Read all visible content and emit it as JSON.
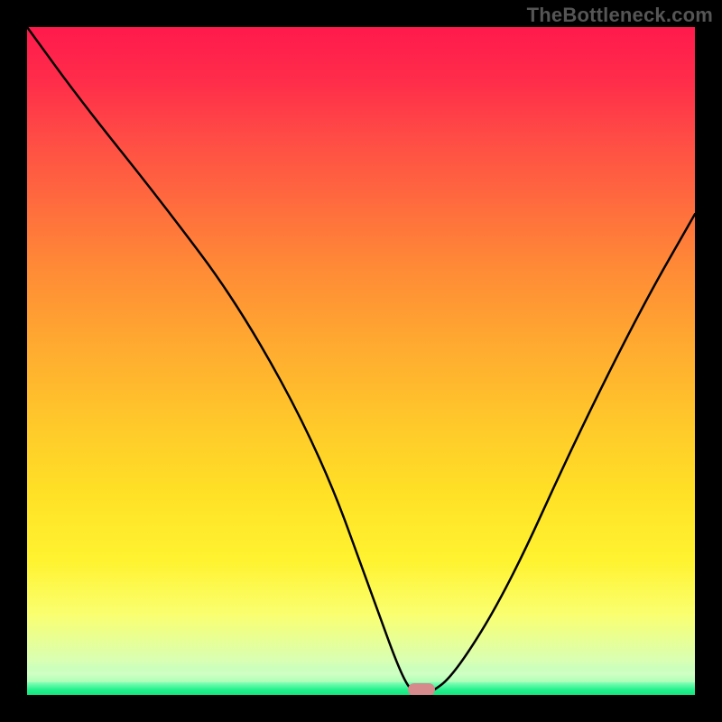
{
  "watermark": "TheBottleneck.com",
  "chart_data": {
    "type": "line",
    "title": "",
    "xlabel": "",
    "ylabel": "",
    "xlim": [
      0,
      100
    ],
    "ylim": [
      0,
      100
    ],
    "series": [
      {
        "name": "bottleneck-curve",
        "x": [
          0,
          8,
          20,
          32,
          44,
          52,
          56,
          58,
          60,
          64,
          72,
          82,
          92,
          100
        ],
        "values": [
          100,
          89,
          74,
          58,
          36,
          14,
          3,
          0,
          0,
          3,
          16,
          38,
          58,
          72
        ]
      }
    ],
    "marker": {
      "x": 59,
      "y": 0,
      "name": "optimal-point"
    },
    "background": {
      "gradient_stops": [
        {
          "pos": 0,
          "color": "#ff1a4c"
        },
        {
          "pos": 50,
          "color": "#ffca2a"
        },
        {
          "pos": 88,
          "color": "#faff70"
        },
        {
          "pos": 100,
          "color": "#22f18c"
        }
      ]
    },
    "grid": false,
    "legend": false
  }
}
